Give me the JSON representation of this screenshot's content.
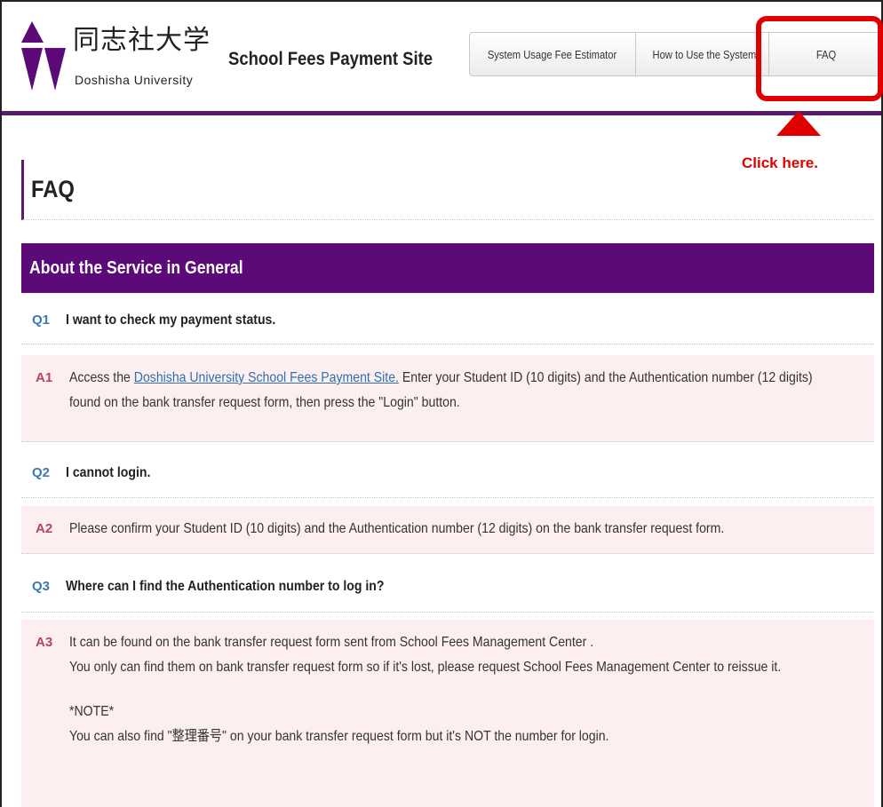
{
  "header": {
    "logo_jp": "同志社大学",
    "logo_en": "Doshisha University",
    "site_title": "School Fees Payment Site"
  },
  "nav": {
    "items": [
      {
        "label": "System Usage Fee Estimator"
      },
      {
        "label": "How to Use the System"
      },
      {
        "label": "FAQ"
      }
    ]
  },
  "annotation": {
    "callout": "Click here.",
    "color": "#e10000"
  },
  "page": {
    "title": "FAQ",
    "section_title": "About the Service in General"
  },
  "faq": {
    "q1": {
      "label": "Q1",
      "text": "I want to check my payment status."
    },
    "a1": {
      "label": "A1",
      "prefix": "Access the ",
      "link": "Doshisha University School Fees Payment Site.",
      "suffix": " Enter your Student ID (10 digits) and the Authentication number (12 digits) found on the bank transfer request form, then press the \"Login\" button."
    },
    "q2": {
      "label": "Q2",
      "text": "I cannot login."
    },
    "a2": {
      "label": "A2",
      "text": "Please confirm your Student ID (10 digits) and the Authentication number (12 digits) on the bank transfer request form."
    },
    "q3": {
      "label": "Q3",
      "text": "Where can I find the Authentication number to log in?"
    },
    "a3": {
      "label": "A3",
      "line1": "It can be found on the bank transfer request form sent from School Fees Management Center .",
      "line2": "You only can find them on bank transfer request form so if it's lost, please request School Fees Management Center to reissue it.",
      "note_title": "*NOTE*",
      "note_text": "You can also find \"整理番号\" on your bank transfer request form but it's NOT the number for login."
    }
  },
  "colors": {
    "brand_purple": "#5b0a78",
    "question_blue": "#3a78b6",
    "answer_pink": "#b4436c",
    "answer_bg": "#fdefef"
  }
}
